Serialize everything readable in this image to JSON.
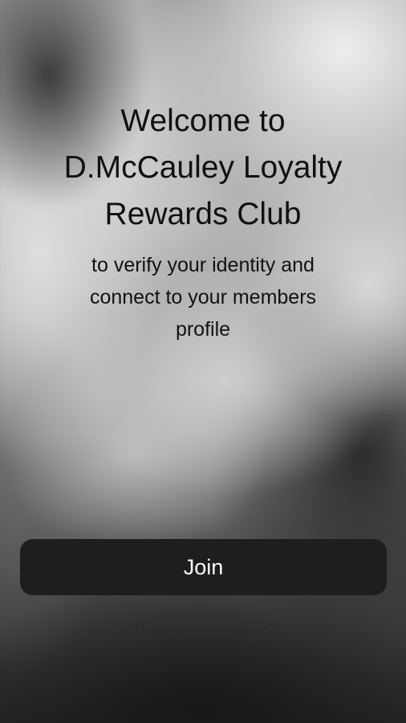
{
  "welcome": {
    "title_line_1": "Welcome to",
    "title_line_2": "D.McCauley Loyalty",
    "title_line_3": "Rewards Club",
    "subtitle_line_1": "to verify your identity and",
    "subtitle_line_2": "connect to your members",
    "subtitle_line_3": "profile"
  },
  "actions": {
    "join_label": "Join",
    "already_member_label": "Already a member?"
  },
  "colors": {
    "button_background": "#1e1e1e",
    "button_text": "#ffffff",
    "heading_text": "#111111"
  }
}
